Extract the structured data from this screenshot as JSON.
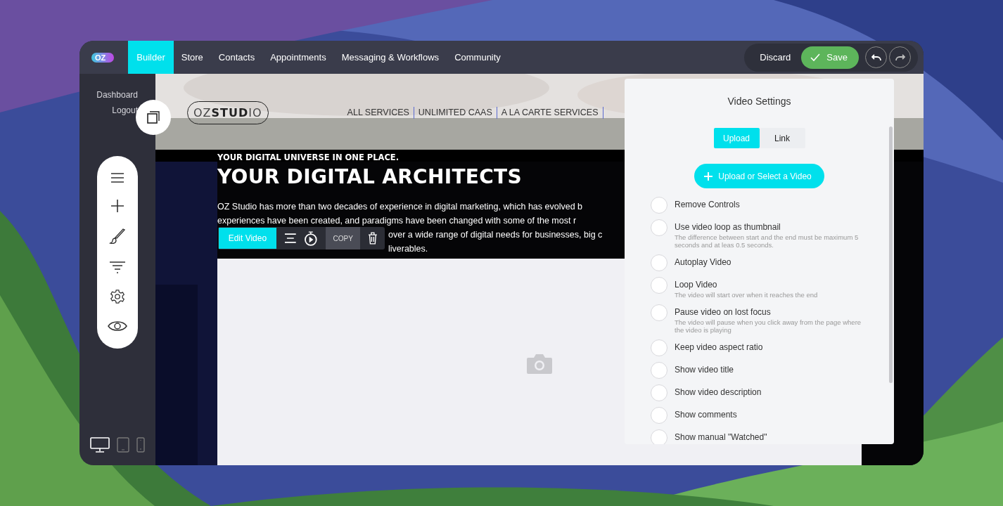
{
  "app_bar": {
    "logo": "OZ",
    "nav": [
      {
        "label": "Builder",
        "selected": true
      },
      {
        "label": "Store",
        "selected": false
      },
      {
        "label": "Contacts",
        "selected": false
      },
      {
        "label": "Appointments",
        "selected": false
      },
      {
        "label": "Messaging & Workflows",
        "selected": false
      },
      {
        "label": "Community",
        "selected": false
      }
    ],
    "discard": "Discard",
    "save": "Save"
  },
  "sidebar": {
    "links": [
      "Dashboard",
      "Logout"
    ],
    "tools": [
      {
        "kind": "menu"
      },
      {
        "kind": "add"
      },
      {
        "kind": "brush"
      },
      {
        "kind": "filter"
      },
      {
        "kind": "settings"
      },
      {
        "kind": "preview"
      }
    ],
    "devices": [
      {
        "kind": "desktop",
        "selected": true
      },
      {
        "kind": "tablet",
        "selected": false
      },
      {
        "kind": "phone",
        "selected": false
      }
    ]
  },
  "site": {
    "logo_light": "OZ",
    "logo_bold": "STUD",
    "logo_end": "IO",
    "nav": [
      "ALL SERVICES",
      "UNLIMITED CAAS",
      "A LA CARTE SERVICES"
    ],
    "eyebrow": "YOUR DIGITAL UNIVERSE IN ONE PLACE.",
    "heading": "YOUR DIGITAL ARCHITECTS",
    "paragraph_lines": [
      {
        "text": "OZ Studio has more than two decades of experience in digital marketing, which has evolved b",
        "partial": false
      },
      {
        "text": "experiences have been created, and paradigms have been changed with some of the most r",
        "partial": false
      },
      {
        "text": "over a wide range of digital needs for businesses, big c",
        "partial": true
      },
      {
        "text": "liverables.",
        "partial": true
      }
    ]
  },
  "element_toolbar": {
    "edit": "Edit Video",
    "copy": "COPY"
  },
  "video_settings": {
    "title": "Video Settings",
    "source_tabs": [
      {
        "label": "Upload",
        "selected": true
      },
      {
        "label": "Link",
        "selected": false
      }
    ],
    "upload_button": "Upload or Select a Video",
    "options": [
      {
        "label": "Remove Controls",
        "checked": false
      },
      {
        "label": "Use video loop as thumbnail",
        "description": "The difference between start and the end must be maximum 5 seconds and at leas 0.5 seconds.",
        "checked": false
      },
      {
        "label": "Autoplay Video",
        "checked": false
      },
      {
        "label": "Loop Video",
        "description": "The video will start over when it reaches the end",
        "checked": false
      },
      {
        "label": "Pause video on lost focus",
        "description": "The video will pause when you click away from the page where the video is playing",
        "checked": false
      },
      {
        "label": "Keep video aspect ratio",
        "checked": false
      },
      {
        "label": "Show video title",
        "checked": false
      },
      {
        "label": "Show video description",
        "checked": false
      },
      {
        "label": "Show comments",
        "checked": false
      },
      {
        "label": "Show manual \"Watched\"",
        "checked": false
      }
    ]
  }
}
